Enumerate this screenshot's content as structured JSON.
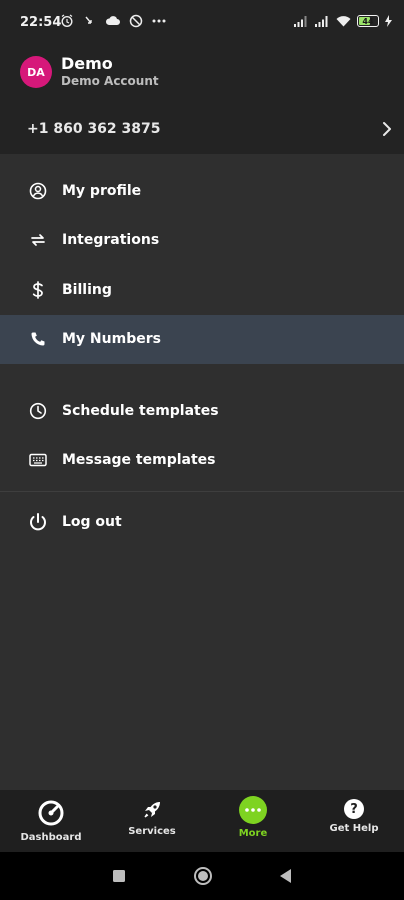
{
  "status_bar": {
    "time": "22:54",
    "battery": "44",
    "icons_left": [
      "alarm-icon",
      "missed-call-icon",
      "cloud-icon",
      "no-disturb-icon",
      "more-dots-icon"
    ],
    "icons_right": [
      "signal-icon",
      "signal-icon",
      "wifi-icon",
      "battery-icon",
      "charging-icon"
    ]
  },
  "account": {
    "initials": "DA",
    "name": "Demo",
    "subtitle": "Demo Account",
    "avatar_color": "#d6187a"
  },
  "phone": {
    "number": "+1 860 362 3875"
  },
  "menu": {
    "group1": [
      {
        "label": "My profile",
        "icon": "user-circle-icon",
        "active": false
      },
      {
        "label": "Integrations",
        "icon": "repeat-arrows-icon",
        "active": false
      },
      {
        "label": "Billing",
        "icon": "dollar-icon",
        "active": false
      },
      {
        "label": "My Numbers",
        "icon": "phone-icon",
        "active": true
      }
    ],
    "group2": [
      {
        "label": "Schedule templates",
        "icon": "clock-icon",
        "active": false
      },
      {
        "label": "Message templates",
        "icon": "keyboard-icon",
        "active": false
      }
    ],
    "group3": [
      {
        "label": "Log out",
        "icon": "power-icon",
        "active": false
      }
    ]
  },
  "bottom_nav": {
    "items": [
      {
        "label": "Dashboard",
        "icon": "dashboard-icon",
        "active": false
      },
      {
        "label": "Services",
        "icon": "rocket-icon",
        "active": false
      },
      {
        "label": "More",
        "icon": "more-circle-icon",
        "active": true
      },
      {
        "label": "Get Help",
        "icon": "help-circle-icon",
        "active": false
      }
    ]
  },
  "colors": {
    "header_bg": "#232323",
    "menu_bg": "#2f2f2f",
    "active_row_bg": "#3b4450",
    "accent_green": "#7ed321",
    "nav_bg": "#1f1f1f"
  },
  "system_nav": [
    "recents-square-icon",
    "home-circle-icon",
    "back-triangle-icon"
  ]
}
